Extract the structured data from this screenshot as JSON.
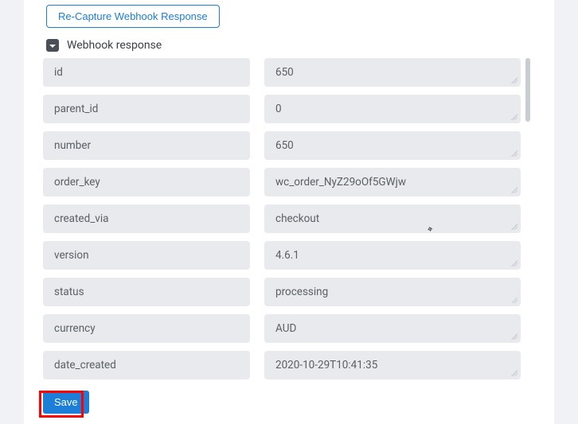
{
  "buttons": {
    "recapture": "Re-Capture Webhook Response",
    "save": "Save"
  },
  "section": {
    "title": "Webhook response"
  },
  "fields": [
    {
      "key": "id",
      "value": "650"
    },
    {
      "key": "parent_id",
      "value": "0"
    },
    {
      "key": "number",
      "value": "650"
    },
    {
      "key": "order_key",
      "value": "wc_order_NyZ29oOf5GWjw"
    },
    {
      "key": "created_via",
      "value": "checkout"
    },
    {
      "key": "version",
      "value": "4.6.1"
    },
    {
      "key": "status",
      "value": "processing"
    },
    {
      "key": "currency",
      "value": "AUD"
    },
    {
      "key": "date_created",
      "value": "2020-10-29T10:41:35"
    }
  ]
}
